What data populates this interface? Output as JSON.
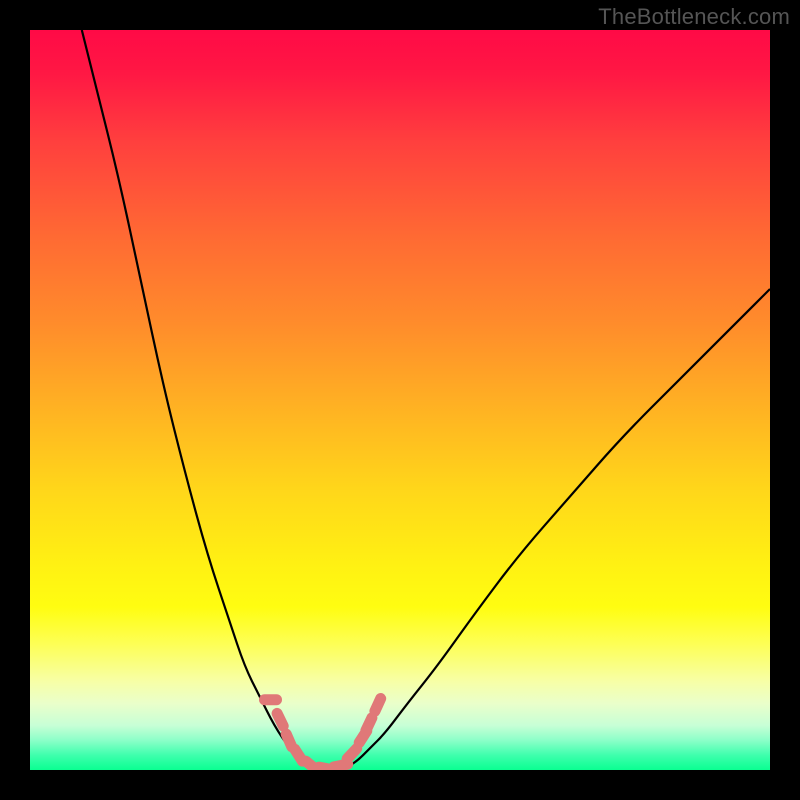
{
  "watermark": "TheBottleneck.com",
  "colors": {
    "notch": "#e07878",
    "curve": "#000000"
  },
  "chart_data": {
    "type": "line",
    "title": "",
    "xlabel": "",
    "ylabel": "",
    "xlim": [
      0,
      100
    ],
    "ylim": [
      0,
      100
    ],
    "grid": false,
    "series": [
      {
        "name": "left_curve",
        "x_norm": [
          7,
          9,
          12,
          15,
          18,
          21,
          24,
          27,
          29,
          31,
          33,
          35,
          37,
          38
        ],
        "y_norm": [
          100,
          92,
          80,
          66,
          52,
          40,
          29,
          20,
          14,
          10,
          6,
          3,
          1,
          0
        ]
      },
      {
        "name": "right_curve",
        "x_norm": [
          42,
          44,
          46,
          48,
          51,
          55,
          60,
          66,
          73,
          80,
          88,
          96,
          100
        ],
        "y_norm": [
          0,
          1,
          3,
          5,
          9,
          14,
          21,
          29,
          37,
          45,
          53,
          61,
          65
        ]
      },
      {
        "name": "bottom_flat",
        "x_norm": [
          38,
          39,
          40,
          41,
          42
        ],
        "y_norm": [
          0,
          0,
          0,
          0,
          0
        ]
      }
    ],
    "notches": [
      {
        "x_norm": 32.5,
        "y_norm": 9.5
      },
      {
        "x_norm": 33.8,
        "y_norm": 6.8
      },
      {
        "x_norm": 35.0,
        "y_norm": 4.0
      },
      {
        "x_norm": 36.3,
        "y_norm": 2.0
      },
      {
        "x_norm": 38.0,
        "y_norm": 0.6
      },
      {
        "x_norm": 40.0,
        "y_norm": 0.2
      },
      {
        "x_norm": 42.0,
        "y_norm": 0.6
      },
      {
        "x_norm": 43.5,
        "y_norm": 2.2
      },
      {
        "x_norm": 45.0,
        "y_norm": 4.5
      },
      {
        "x_norm": 45.8,
        "y_norm": 6.2
      },
      {
        "x_norm": 47.0,
        "y_norm": 8.8
      }
    ]
  }
}
